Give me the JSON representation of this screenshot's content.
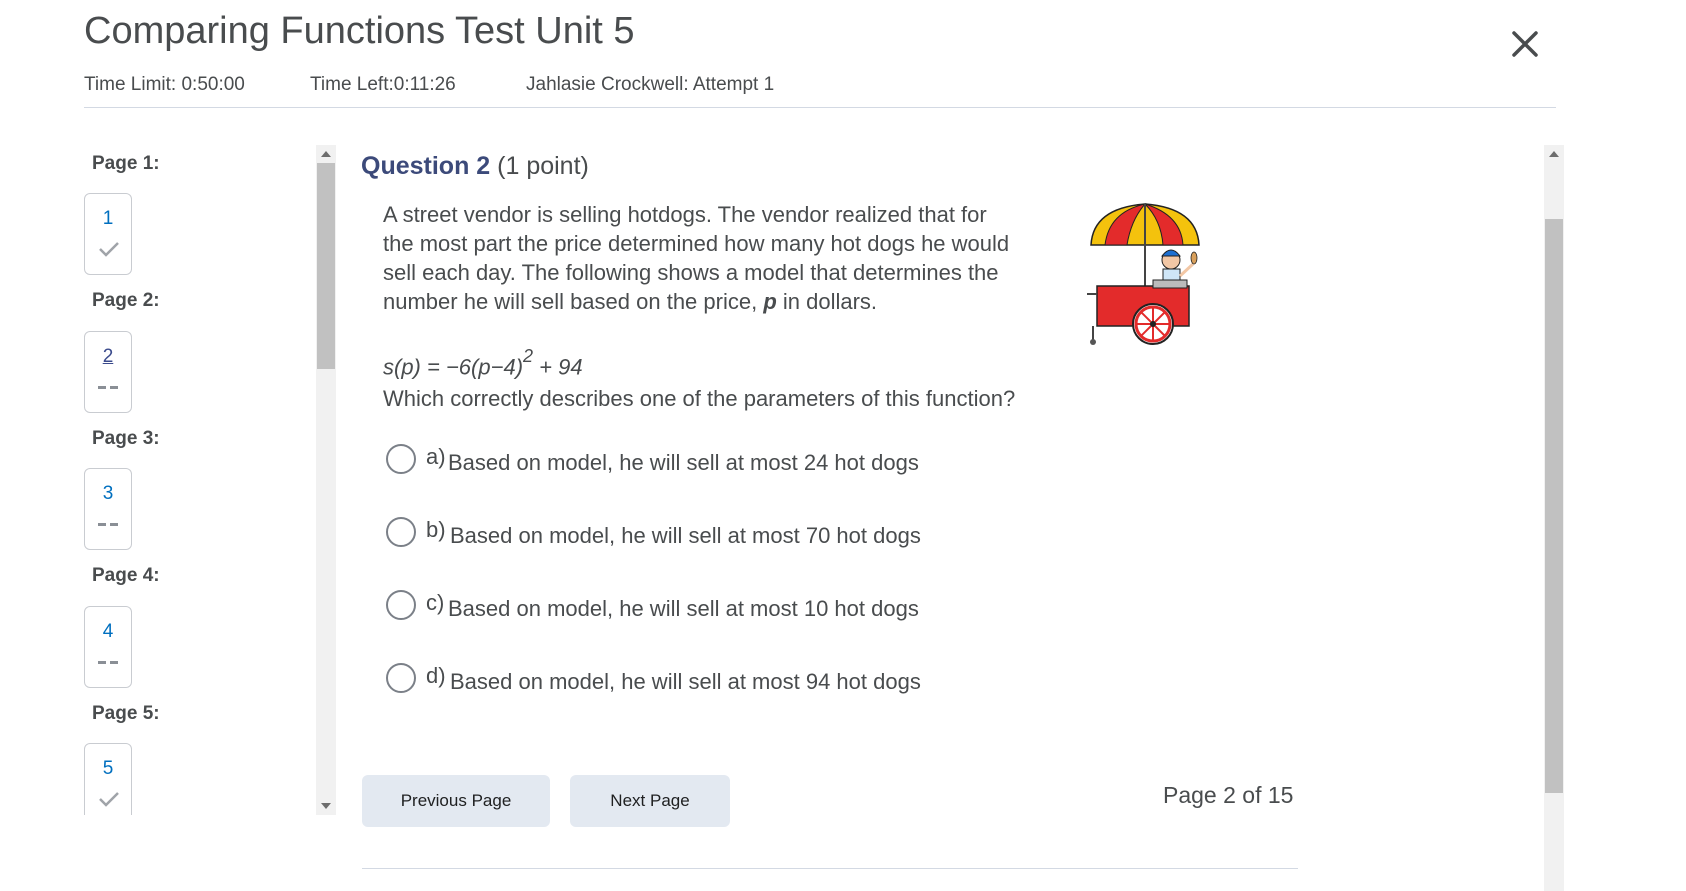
{
  "header": {
    "title": "Comparing Functions Test Unit 5",
    "time_limit": "Time Limit: 0:50:00",
    "time_left": "Time Left:0:11:26",
    "attempt": "Jahlasie Crockwell: Attempt 1",
    "close_icon": "close-icon"
  },
  "nav": {
    "pages": [
      {
        "label": "Page 1:",
        "num": "1",
        "status": "answered"
      },
      {
        "label": "Page 2:",
        "num": "2",
        "status": "current"
      },
      {
        "label": "Page 3:",
        "num": "3",
        "status": "unanswered"
      },
      {
        "label": "Page 4:",
        "num": "4",
        "status": "unanswered"
      },
      {
        "label": "Page 5:",
        "num": "5",
        "status": "answered"
      }
    ]
  },
  "question": {
    "title": "Question 2",
    "points": "(1 point)",
    "text_line1": "A street vendor is selling hotdogs.  The vendor realized that for",
    "text_line2": "the most part the price determined how many hot dogs he would",
    "text_line3": "sell each day. The following shows a model that determines the",
    "text_line4_pre": "number he will sell based on the price, ",
    "text_line4_var": "p",
    "text_line4_post": " in dollars.",
    "formula_pre": "s(p) = −6(p−4)",
    "formula_exp": "2",
    "formula_post": " + 94",
    "prompt": "Which correctly describes one of the parameters of this function?",
    "image": "hot-dog-cart-illustration",
    "options": [
      {
        "letter": "a)",
        "text": "Based on model, he will sell at most 24 hot dogs"
      },
      {
        "letter": "b)",
        "text": "Based on model, he will sell at most 70 hot dogs"
      },
      {
        "letter": "c)",
        "text": "Based on model, he will sell at most 10 hot dogs"
      },
      {
        "letter": "d)",
        "text": "Based on model, he will sell at most 94 hot dogs"
      }
    ]
  },
  "footer": {
    "previous_label": "Previous Page",
    "next_label": "Next Page",
    "page_indicator": "Page 2 of 15"
  }
}
